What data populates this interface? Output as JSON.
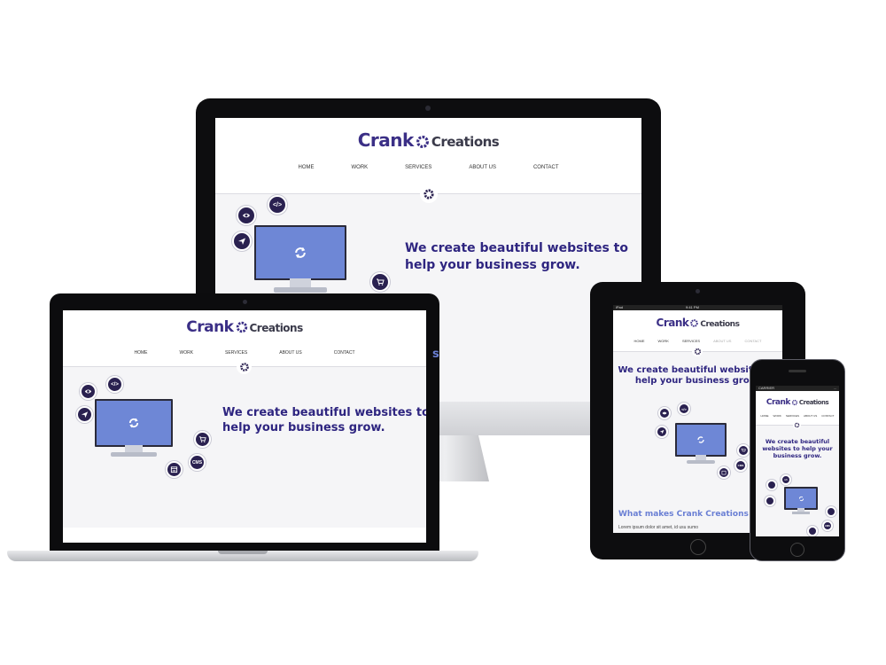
{
  "brand": {
    "word1": "Crank",
    "word2": "Creations",
    "primary_color": "#3b2f86",
    "accent_color": "#6e87d6"
  },
  "nav": {
    "items": [
      {
        "label": "HOME"
      },
      {
        "label": "WORK"
      },
      {
        "label": "SERVICES"
      },
      {
        "label": "ABOUT US"
      },
      {
        "label": "CONTACT"
      }
    ]
  },
  "hero": {
    "line1": "We create beautiful websites to",
    "line2": "help your business grow.",
    "tablet_line1": "We create beautiful websites to",
    "tablet_line2": "help your business grow.",
    "phone_line1": "We create beautiful",
    "phone_line2": "websites to help your",
    "phone_line3": "business grow."
  },
  "icons": {
    "bubbles": [
      "eye-icon",
      "code-icon",
      "send-icon",
      "cart-icon",
      "cms-icon",
      "calendar-icon"
    ],
    "cms_label": "CMS",
    "code_label": "</>"
  },
  "desktop_peek": {
    "label": "s"
  },
  "tablet": {
    "status_left": "iPad",
    "status_center": "9:41 PM",
    "section_title": "What makes Crank Creations",
    "body_text": "Lorem ipsum dolor sit amet, id usu sumo"
  },
  "phone": {
    "status_left": "CARRIER",
    "status_right": "..."
  }
}
